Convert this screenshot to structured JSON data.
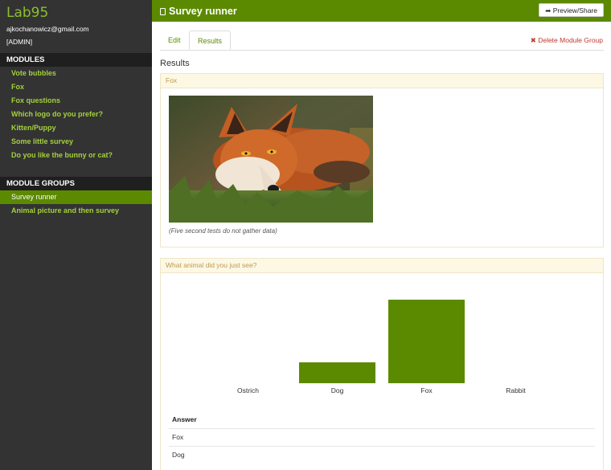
{
  "sidebar": {
    "brand": "Lab95",
    "email": "ajkochanowicz@gmail.com",
    "role": "[ADMIN]",
    "modules_heading": "MODULES",
    "modules": [
      "Vote bubbles",
      "Fox",
      "Fox questions",
      "Which logo do you prefer?",
      "Kitten/Puppy",
      "Some little survey",
      "Do you like the bunny or cat?"
    ],
    "groups_heading": "MODULE GROUPS",
    "groups": [
      "Survey runner",
      "Animal picture and then survey"
    ],
    "active_group": "Survey runner"
  },
  "header": {
    "title": "Survey runner",
    "share_label": "Preview/Share"
  },
  "tabs": [
    {
      "label": "Edit",
      "active": false
    },
    {
      "label": "Results",
      "active": true
    }
  ],
  "delete_label": "Delete Module Group",
  "results_heading": "Results",
  "image_panel": {
    "title": "Fox",
    "caption": "(Five second tests do not gather data)"
  },
  "question_panel": {
    "title": "What animal did you just see?",
    "answer_header": "Answer",
    "answers": [
      "Fox",
      "Dog"
    ]
  },
  "chart_data": {
    "type": "bar",
    "categories": [
      "Ostrich",
      "Dog",
      "Fox",
      "Rabbit"
    ],
    "values": [
      0,
      1,
      4,
      0
    ],
    "ylim": [
      0,
      4
    ],
    "color": "#5b8a00"
  },
  "colors": {
    "accent": "#5b8a00",
    "sidebar_bg": "#333333",
    "link": "#a4d03c",
    "danger": "#c0392b"
  }
}
